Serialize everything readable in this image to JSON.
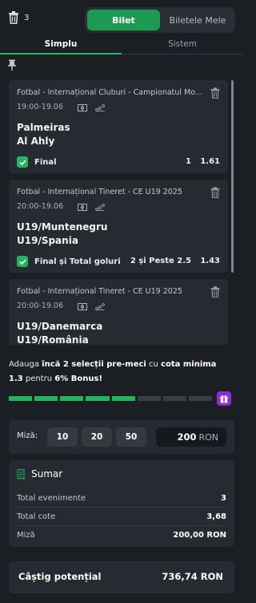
{
  "header": {
    "selection_count": "3",
    "toggle": {
      "active": "Bilet",
      "inactive": "Biletele Mele"
    }
  },
  "tabs": {
    "simplu": "Simplu",
    "sistem": "Sistem"
  },
  "bets": [
    {
      "league": "Fotbal - Internațional Cluburi - Campionatul Mo...",
      "time": "19:00-19.06",
      "home": "Palmeiras",
      "away": "Al Ahly",
      "market": "Final",
      "pick": "1",
      "odd": "1.61"
    },
    {
      "league": "Fotbal - Internațional Tineret - CE U19 2025",
      "time": "20:00-19.06",
      "home": "U19/Muntenegru",
      "away": "U19/Spania",
      "market": "Final și Total goluri",
      "pick": "2 și Peste 2.5",
      "odd": "1.43"
    },
    {
      "league": "Fotbal - Internațional Tineret - CE U19 2025",
      "time": "20:00-19.06",
      "home": "U19/Danemarca",
      "away": "U19/România"
    }
  ],
  "bonus": {
    "p1": "Adauga ",
    "b1": "încă 2 selecții pre-meci",
    "p2": " cu ",
    "b2": "cota minima 1.3",
    "p3": " pentru ",
    "b3": "6% Bonus!",
    "progress": {
      "segments": 8,
      "filled": 5
    }
  },
  "stake": {
    "label": "Miză:",
    "chips": [
      "10",
      "20",
      "50"
    ],
    "value": "200",
    "currency": "RON"
  },
  "summary": {
    "title": "Sumar",
    "rows": [
      {
        "label": "Total evenimente",
        "value": "3"
      },
      {
        "label": "Total cote",
        "value": "3,68"
      },
      {
        "label": "Miză",
        "value": "200,00 RON"
      }
    ]
  },
  "potential_win": {
    "label": "Câștig potențial",
    "value": "736,74 RON"
  },
  "colors": {
    "accent": "#22b45f",
    "toggle_active": "#1f9a52",
    "gift": "#8d2ad6",
    "card": "#262a31",
    "background": "#1b1e23"
  }
}
